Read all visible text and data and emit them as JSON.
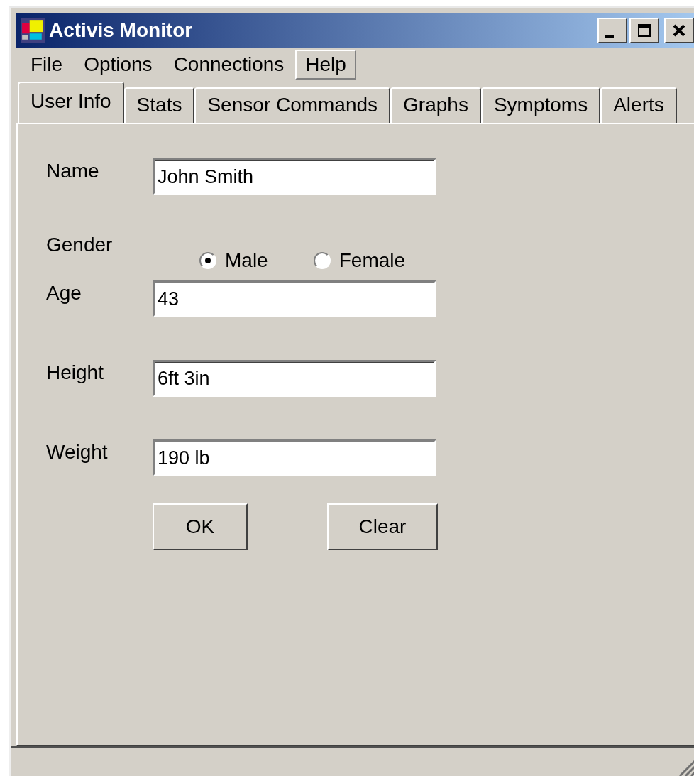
{
  "window": {
    "title": "Activis Monitor"
  },
  "menu": [
    {
      "label": "File",
      "highlighted": false
    },
    {
      "label": "Options",
      "highlighted": false
    },
    {
      "label": "Connections",
      "highlighted": false
    },
    {
      "label": "Help",
      "highlighted": true
    }
  ],
  "tabs": [
    {
      "label": "User Info",
      "selected": true
    },
    {
      "label": "Stats",
      "selected": false
    },
    {
      "label": "Sensor Commands",
      "selected": false
    },
    {
      "label": "Graphs",
      "selected": false
    },
    {
      "label": "Symptoms",
      "selected": false
    },
    {
      "label": "Alerts",
      "selected": false
    }
  ],
  "fields": [
    {
      "kind": "text",
      "label": "Name",
      "value": "John Smith"
    },
    {
      "kind": "radio",
      "label": "Gender",
      "options": [
        {
          "label": "Male",
          "selected": true
        },
        {
          "label": "Female",
          "selected": false
        }
      ]
    },
    {
      "kind": "text",
      "label": "Age",
      "value": "43"
    },
    {
      "kind": "text",
      "label": "Height",
      "value": "6ft 3in"
    },
    {
      "kind": "text",
      "label": "Weight",
      "value": "190 lb"
    }
  ],
  "buttons": [
    "OK",
    "Clear"
  ]
}
